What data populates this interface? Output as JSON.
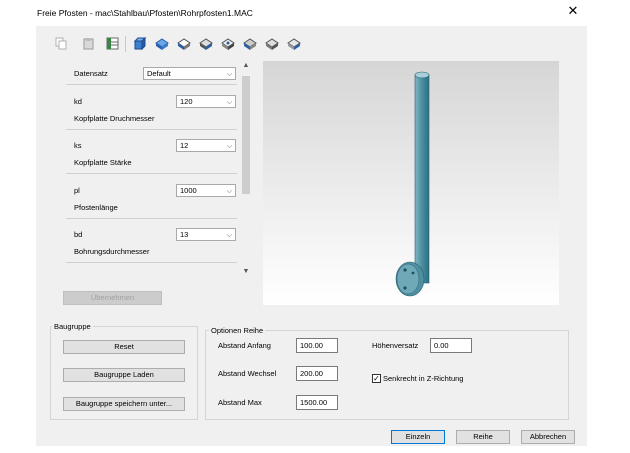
{
  "window": {
    "title": "Freie Pfosten - mac\\Stahlbau\\Pfosten\\Rohrpfosten1.MAC",
    "close_glyph": "✕"
  },
  "toolbar": {
    "icons": [
      "copy-icon",
      "paste-icon",
      "table-icon",
      "view-3d-icon",
      "view-front-icon",
      "view-top-icon",
      "view-side-icon",
      "view-iso-1-icon",
      "view-iso-2-icon",
      "view-iso-3-icon",
      "view-iso-4-icon"
    ]
  },
  "params": {
    "datensatz_label": "Datensatz",
    "datensatz_value": "Default",
    "rows": [
      {
        "code": "kd",
        "value": "120",
        "desc": "Kopfplatte Druchmesser"
      },
      {
        "code": "ks",
        "value": "12",
        "desc": "Kopfplatte Stärke"
      },
      {
        "code": "pl",
        "value": "1000",
        "desc": "Pfostenlänge"
      },
      {
        "code": "bd",
        "value": "13",
        "desc": "Bohrungsdurchmesser"
      }
    ],
    "apply_label": "Übernehmen"
  },
  "baugruppe": {
    "label": "Baugruppe",
    "reset": "Reset",
    "laden": "Baugruppe Laden",
    "speichern": "Baugruppe speichern unter..."
  },
  "optionen": {
    "label": "Optionen Reihe",
    "abstand_anfang_label": "Abstand Anfang",
    "abstand_anfang": "100.00",
    "abstand_wechsel_label": "Abstand Wechsel",
    "abstand_wechsel": "200.00",
    "abstand_max_label": "Abstand Max",
    "abstand_max": "1500.00",
    "hoehenversatz_label": "Höhenversatz",
    "hoehenversatz": "0.00",
    "senkrecht_label": "Senkrecht in Z-Richtung",
    "senkrecht_checked": true
  },
  "footer": {
    "einzeln": "Einzeln",
    "reihe": "Reihe",
    "abbrechen": "Abbrechen"
  }
}
